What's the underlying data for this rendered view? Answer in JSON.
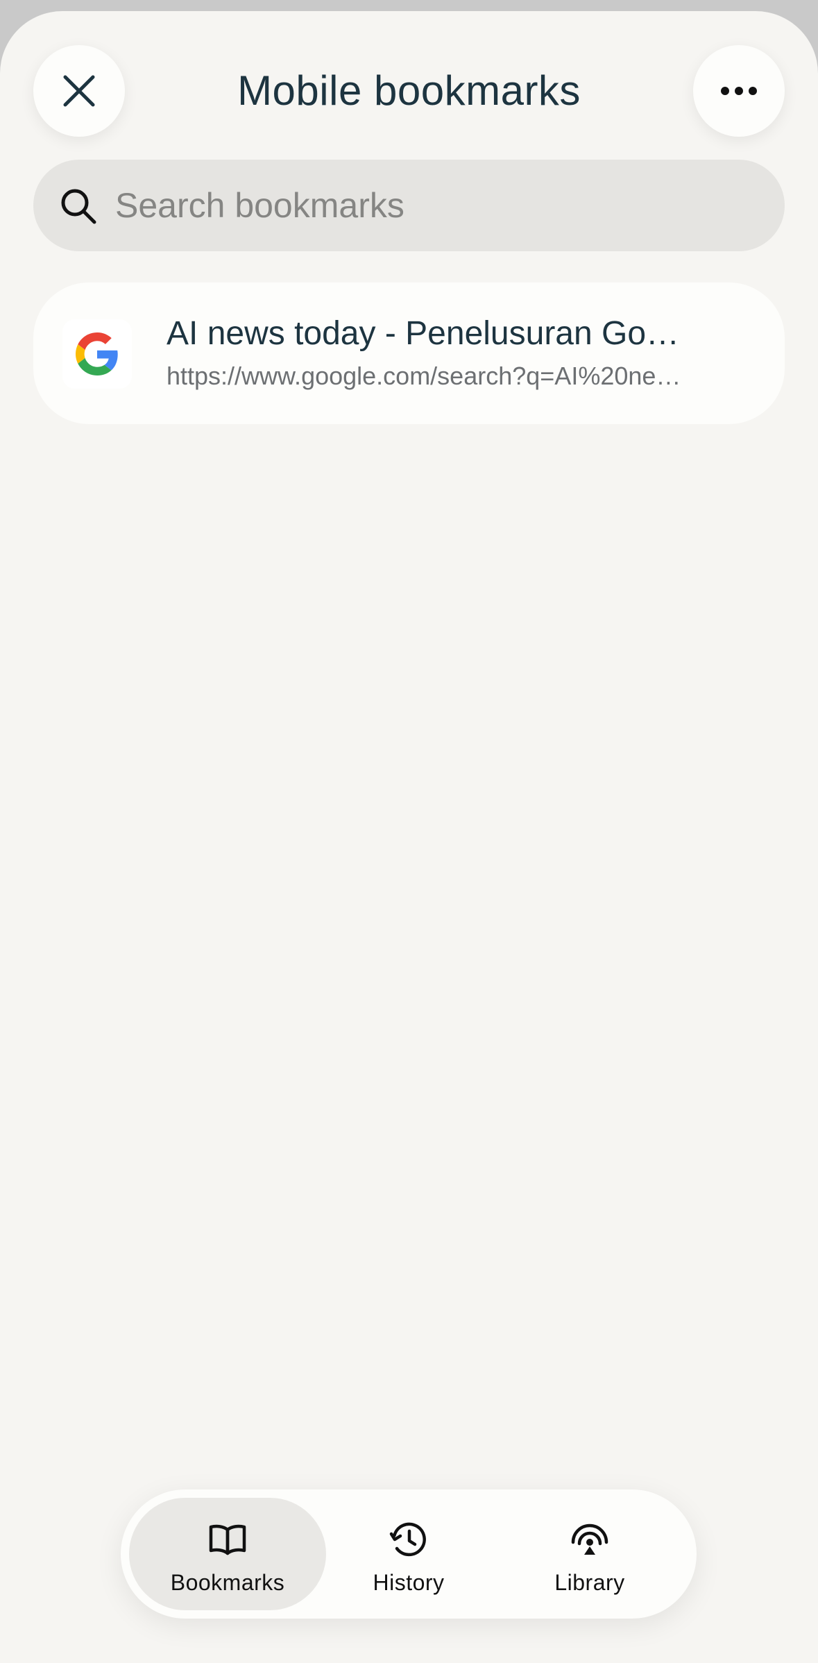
{
  "header": {
    "title": "Mobile bookmarks",
    "close_icon": "close-icon",
    "more_icon": "more-horizontal-icon"
  },
  "search": {
    "placeholder": "Search bookmarks",
    "value": "",
    "icon": "search-icon"
  },
  "bookmarks": [
    {
      "title": "AI news today - Penelusuran Go…",
      "url": "https://www.google.com/search?q=AI%20ne…",
      "icon": "google-favicon-icon"
    }
  ],
  "tabbar": {
    "active": "Bookmarks",
    "tabs": [
      {
        "label": "Bookmarks",
        "icon": "book-open-icon"
      },
      {
        "label": "History",
        "icon": "history-clock-icon"
      },
      {
        "label": "Library",
        "icon": "library-broadcast-icon"
      }
    ]
  },
  "colors": {
    "background": "#f6f5f2",
    "card": "#fdfdfb",
    "search_bg": "#e5e4e1",
    "title_text": "#1d3440",
    "active_tab": "#e9e8e5"
  }
}
